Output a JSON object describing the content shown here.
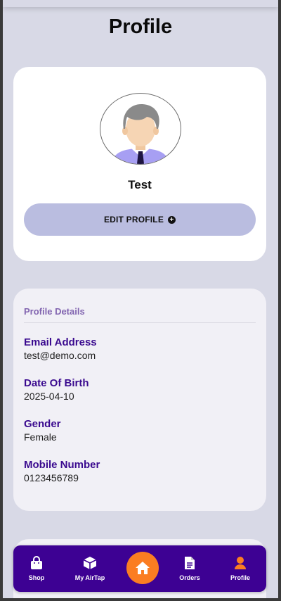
{
  "header": {
    "title": "Profile"
  },
  "profile": {
    "name": "Test",
    "avatar_icon": "user-avatar-illustration",
    "edit_button_label": "EDIT PROFILE",
    "edit_button_icon": "plus-circle-icon"
  },
  "details": {
    "section_title": "Profile Details",
    "fields": [
      {
        "label": "Email Address",
        "value": "test@demo.com"
      },
      {
        "label": "Date Of Birth",
        "value": "2025-04-10"
      },
      {
        "label": "Gender",
        "value": "Female"
      },
      {
        "label": "Mobile Number",
        "value": "0123456789"
      }
    ]
  },
  "bottom_nav": {
    "items": [
      {
        "label": "Shop",
        "icon": "shopping-bag-icon"
      },
      {
        "label": "My AirTap",
        "icon": "box-icon"
      },
      {
        "label": "Orders",
        "icon": "document-icon"
      },
      {
        "label": "Profile",
        "icon": "user-icon",
        "active": true
      }
    ],
    "home_icon": "home-icon"
  },
  "colors": {
    "background": "#d8d9e6",
    "edit_button": "#babde0",
    "field_label": "#3a0a8f",
    "section_title": "#8265b0",
    "nav_background": "#3d0193",
    "nav_active": "#fb7d22",
    "home_button": "#fb7d22"
  }
}
